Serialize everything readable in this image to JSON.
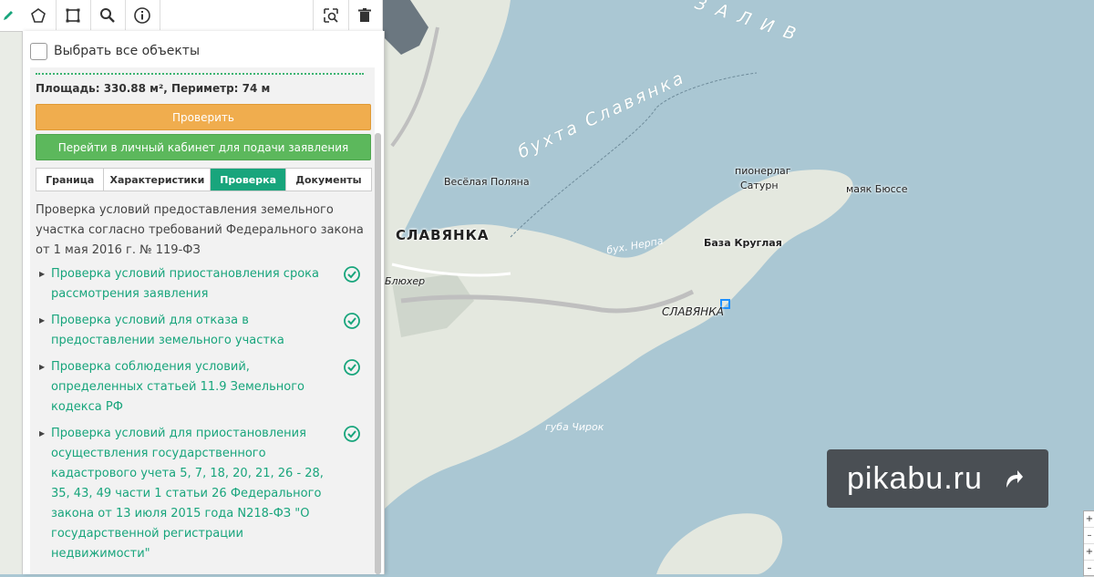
{
  "toolbar": {
    "buttons": [
      "edit-icon",
      "polygon-icon",
      "rectangle-icon",
      "search-icon",
      "info-icon",
      "zoom-area-icon",
      "trash-icon"
    ]
  },
  "panel": {
    "select_all_label": "Выбрать все объекты",
    "area_text": "Площадь: 330.88 м², Периметр: 74 м",
    "check_button": "Проверить",
    "goto_button": "Перейти в личный кабинет для подачи заявления",
    "tabs": [
      {
        "label": "Граница",
        "active": false
      },
      {
        "label": "Характеристики",
        "active": false
      },
      {
        "label": "Проверка",
        "active": true
      },
      {
        "label": "Документы",
        "active": false
      }
    ],
    "description": "Проверка условий предоставления земельного участка согласно требований Федерального закона от 1 мая 2016 г. № 119-ФЗ",
    "checks": [
      {
        "text": "Проверка условий приостановления срока рассмотрения заявления"
      },
      {
        "text": "Проверка условий для отказа в предоставлении земельного участка"
      },
      {
        "text": "Проверка соблюдения условий, определенных статьей 11.9 Земельного кодекса РФ"
      },
      {
        "text": "Проверка условий для приостановления осуществления государственного кадастрового учета 5, 7, 18, 20, 21, 26 - 28, 35, 43, 49 части 1 статьи 26 Федерального закона от 13 июля 2015 года N218-ФЗ \"О государственной регистрации недвижимости\""
      }
    ]
  },
  "map": {
    "labels": {
      "zaliv": "З А Л И В",
      "bukhta": "бухта Славянка",
      "vesyolaya": "Весёлая Поляна",
      "slavyanka_city": "СЛАВЯНКА",
      "nerpa": "бух. Нерпа",
      "blyuher": "Блюхер",
      "pionerlag": "пионерлаг",
      "saturn": "Сатурн",
      "mayak": "маяк Бюссе",
      "baza": "База Круглая",
      "slavyanka_small": "СЛАВЯНКА",
      "chirok": "губа Чирок"
    },
    "colors": {
      "water": "#aac7d3",
      "land": "#e6e9e2",
      "accent": "#18a57c"
    }
  },
  "watermark": {
    "text": "pikabu.ru"
  },
  "zoom_controls": [
    "+",
    "–",
    "+",
    "–"
  ]
}
